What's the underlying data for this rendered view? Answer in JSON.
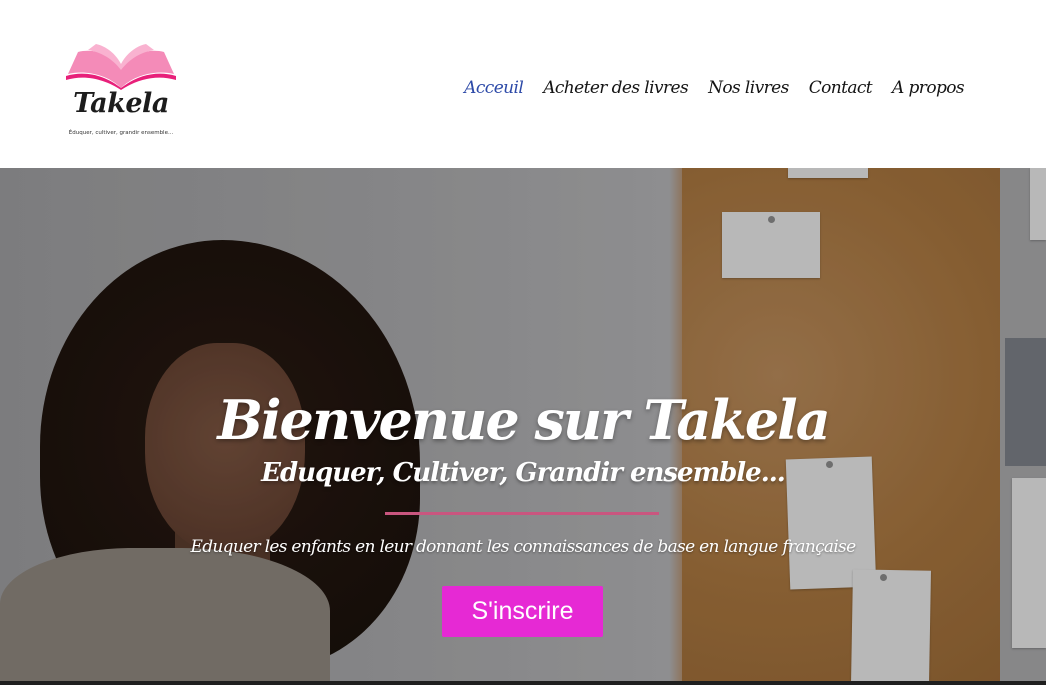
{
  "brand": {
    "name": "Takela",
    "tagline": "Éduquer, cultiver, grandir ensemble...",
    "colors": {
      "pink": "#e629d4",
      "nav_active": "#2d4aa8",
      "divider": "#c9567f"
    }
  },
  "nav": {
    "items": [
      {
        "label": "Acceuil",
        "active": true
      },
      {
        "label": "Acheter des livres",
        "active": false
      },
      {
        "label": "Nos livres",
        "active": false
      },
      {
        "label": "Contact",
        "active": false
      },
      {
        "label": "A propos",
        "active": false
      }
    ]
  },
  "hero": {
    "title": "Bienvenue sur Takela",
    "subtitle": "Eduquer, Cultiver, Grandir ensemble...",
    "description": "Eduquer les enfants en leur donnant les connaissances de base en langue française",
    "cta_label": "S'inscrire"
  },
  "icons": {
    "logo": "open-book-icon"
  }
}
